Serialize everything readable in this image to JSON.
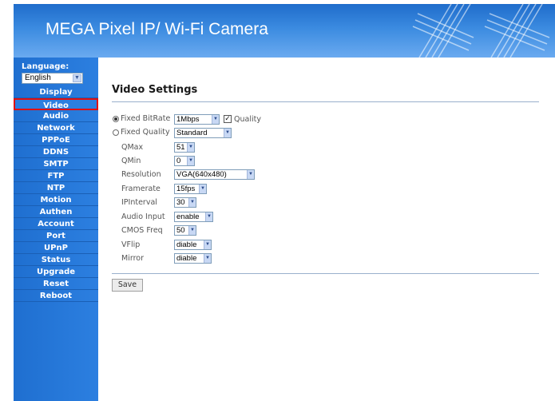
{
  "header": {
    "title": "MEGA Pixel IP/ Wi-Fi Camera"
  },
  "sidebar": {
    "language_label": "Language:",
    "language_value": "English",
    "items": [
      {
        "label": "Display"
      },
      {
        "label": "Video"
      },
      {
        "label": "Audio"
      },
      {
        "label": "Network"
      },
      {
        "label": "PPPoE"
      },
      {
        "label": "DDNS"
      },
      {
        "label": "SMTP"
      },
      {
        "label": "FTP"
      },
      {
        "label": "NTP"
      },
      {
        "label": "Motion"
      },
      {
        "label": "Authen"
      },
      {
        "label": "Account"
      },
      {
        "label": "Port"
      },
      {
        "label": "UPnP"
      },
      {
        "label": "Status"
      },
      {
        "label": "Upgrade"
      },
      {
        "label": "Reset"
      },
      {
        "label": "Reboot"
      }
    ],
    "active_item": "Video"
  },
  "main": {
    "title": "Video Settings",
    "fixed_bitrate_label": "Fixed BitRate",
    "fixed_bitrate_value": "1Mbps",
    "quality_checkbox_label": "Quality",
    "fixed_quality_label": "Fixed Quality",
    "fixed_quality_value": "Standard",
    "fields": [
      {
        "label": "QMax",
        "value": "51"
      },
      {
        "label": "QMin",
        "value": "0"
      },
      {
        "label": "Resolution",
        "value": "VGA(640x480)"
      },
      {
        "label": "Framerate",
        "value": "15fps"
      },
      {
        "label": "IPInterval",
        "value": "30"
      },
      {
        "label": "Audio Input",
        "value": "enable"
      },
      {
        "label": "CMOS Freq",
        "value": "50"
      },
      {
        "label": "VFlip",
        "value": "diable"
      },
      {
        "label": "Mirror",
        "value": "diable"
      }
    ],
    "save_label": "Save"
  },
  "colors": {
    "header_blue": "#2c7fe0",
    "sidebar_blue": "#2c7fe0",
    "active_outline": "#e01010"
  }
}
